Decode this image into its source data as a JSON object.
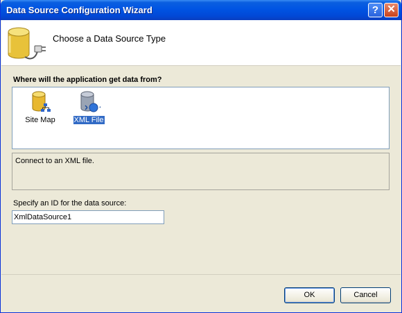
{
  "window": {
    "title": "Data Source Configuration Wizard"
  },
  "header": {
    "title": "Choose a Data Source Type",
    "icon": "database-plug-icon"
  },
  "source_type": {
    "question": "Where will the application get data from?",
    "items": [
      {
        "label": "Site Map",
        "icon": "sitemap-database-icon",
        "selected": false
      },
      {
        "label": "XML File",
        "icon": "xml-database-icon",
        "selected": true
      }
    ],
    "description": "Connect to an XML file."
  },
  "id_field": {
    "label": "Specify an ID for the data source:",
    "value": "XmlDataSource1"
  },
  "buttons": {
    "ok": "OK",
    "cancel": "Cancel"
  },
  "colors": {
    "titlebar": "#0054e3",
    "selection": "#316ac5",
    "dialog_bg": "#ece9d8"
  }
}
